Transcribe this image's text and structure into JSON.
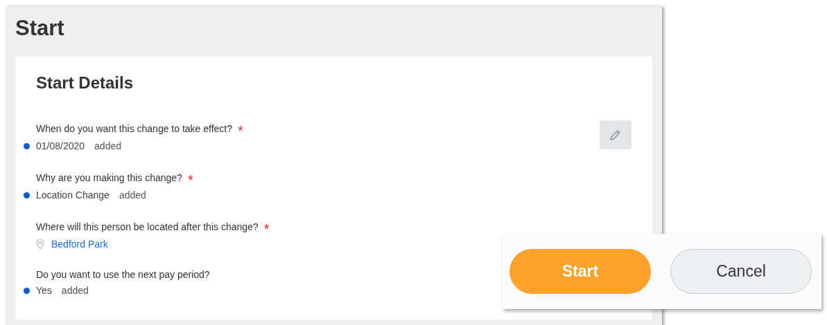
{
  "page": {
    "title": "Start"
  },
  "card": {
    "title": "Start Details",
    "fields": [
      {
        "question": "When do you want this change to take effect?",
        "required_mark": "*",
        "kind": "added",
        "value": "01/08/2020",
        "status": "added"
      },
      {
        "question": "Why are you making this change?",
        "required_mark": "*",
        "kind": "added",
        "value": "Location Change",
        "status": "added"
      },
      {
        "question": "Where will this person be located after this change?",
        "required_mark": "*",
        "kind": "location",
        "value": "Bedford Park"
      },
      {
        "question": "Do you want to use the next pay period?",
        "kind": "added",
        "value": "Yes",
        "status": "added"
      }
    ]
  },
  "buttons": [
    {
      "label": "Start",
      "kind": "primary"
    },
    {
      "label": "Cancel",
      "kind": "secondary"
    }
  ]
}
